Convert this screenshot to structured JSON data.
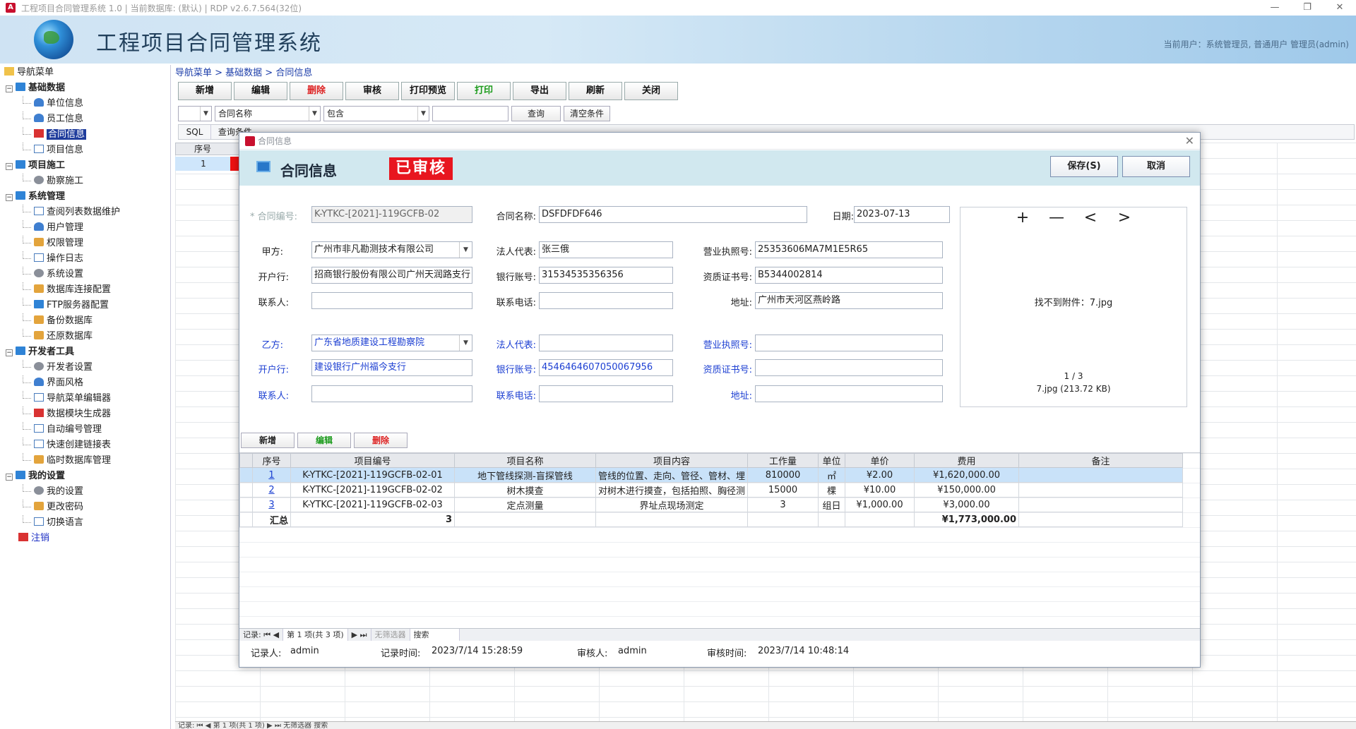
{
  "window": {
    "title": "工程项目合同管理系统 1.0 | 当前数据库: (默认) | RDP v2.6.7.564(32位)",
    "min": "—",
    "max": "❐",
    "close": "✕"
  },
  "banner": {
    "app_title": "工程项目合同管理系统",
    "current_user": "当前用户：系统管理员, 普通用户 管理员(admin)"
  },
  "nav": {
    "root": "导航菜单",
    "groups": [
      {
        "label": "基础数据",
        "items": [
          "单位信息",
          "员工信息",
          "合同信息",
          "项目信息"
        ]
      },
      {
        "label": "项目施工",
        "items": [
          "勘察施工"
        ]
      },
      {
        "label": "系统管理",
        "items": [
          "查阅列表数据维护",
          "用户管理",
          "权限管理",
          "操作日志",
          "系统设置",
          "数据库连接配置",
          "FTP服务器配置",
          "备份数据库",
          "还原数据库"
        ]
      },
      {
        "label": "开发者工具",
        "items": [
          "开发者设置",
          "界面风格",
          "导航菜单编辑器",
          "数据模块生成器",
          "自动编号管理",
          "快速创建链接表",
          "临时数据库管理"
        ]
      },
      {
        "label": "我的设置",
        "items": [
          "我的设置",
          "更改密码",
          "切换语言"
        ]
      }
    ],
    "logout": "注销"
  },
  "breadcrumb": "导航菜单 > 基础数据 > 合同信息",
  "toolbar": {
    "new": "新增",
    "edit": "编辑",
    "delete": "删除",
    "audit": "审核",
    "print_preview": "打印预览",
    "print": "打印",
    "export": "导出",
    "refresh": "刷新",
    "close": "关闭"
  },
  "filter": {
    "field": "合同名称",
    "op": "包含",
    "query": "查询",
    "clear": "清空条件",
    "sql": "SQL",
    "cond": "查询条件"
  },
  "bg_grid": {
    "col": "序号",
    "row1": "1",
    "status": "记录: ⏮ ◀ 第 1 项(共 1 项) ▶ ⏭ 无筛选器 搜索"
  },
  "dialog": {
    "titlebar": "合同信息",
    "header": "合同信息",
    "status_badge": "已审核",
    "save": "保存(S)",
    "cancel": "取消",
    "labels": {
      "contract_no": "* 合同编号:",
      "contract_name": "合同名称:",
      "date": "日期:",
      "party_a": "甲方:",
      "legal_rep": "法人代表:",
      "license": "营业执照号:",
      "bank": "开户行:",
      "account": "银行账号:",
      "cert": "资质证书号:",
      "contact": "联系人:",
      "phone": "联系电话:",
      "address": "地址:",
      "party_b": "乙方:"
    },
    "values": {
      "contract_no": "K-YTKC-[2021]-119GCFB-02",
      "contract_name": "DSFDFDF646",
      "date": "2023-07-13",
      "a_name": "广州市非凡勘测技术有限公司",
      "a_rep": "张三俄",
      "a_license": "25353606MA7M1E5R65",
      "a_bank": "招商银行股份有限公司广州天润路支行",
      "a_account": "31534535356356",
      "a_cert": "B5344002814",
      "a_contact": "",
      "a_phone": "",
      "a_address": "广州市天河区燕岭路",
      "b_name": "广东省地质建设工程勘察院",
      "b_rep": "",
      "b_license": "",
      "b_bank": "建设银行广州福今支行",
      "b_account": "4546464607050067956",
      "b_cert": "",
      "b_contact": "",
      "b_phone": "",
      "b_address": ""
    },
    "image": {
      "zoom_in": "+",
      "zoom_out": "—",
      "prev": "<",
      "next": ">",
      "not_found": "找不到附件：7.jpg",
      "page": "1 / 3",
      "file": "7.jpg (213.72 KB)"
    },
    "detail_toolbar": {
      "new": "新增",
      "edit": "编辑",
      "delete": "删除"
    },
    "table": {
      "headers": [
        "序号",
        "项目编号",
        "项目名称",
        "项目内容",
        "工作量",
        "单位",
        "单价",
        "费用",
        "备注"
      ],
      "rows": [
        [
          "1",
          "K-YTKC-[2021]-119GCFB-02-01",
          "地下管线探测-盲探管线",
          "管线的位置、走向、管径、管材、埋",
          "810000",
          "㎡",
          "¥2.00",
          "¥1,620,000.00",
          ""
        ],
        [
          "2",
          "K-YTKC-[2021]-119GCFB-02-02",
          "树木摸查",
          "对树木进行摸查，包括拍照、胸径测",
          "15000",
          "棵",
          "¥10.00",
          "¥150,000.00",
          ""
        ],
        [
          "3",
          "K-YTKC-[2021]-119GCFB-02-03",
          "定点测量",
          "界址点现场测定",
          "3",
          "组日",
          "¥1,000.00",
          "¥3,000.00",
          ""
        ]
      ],
      "summary": {
        "label": "汇总",
        "count": "3",
        "total": "¥1,773,000.00"
      }
    },
    "status": {
      "record": "记录: ⏮ ◀",
      "pos": "第 1 项(共 3 项)",
      "nav": "▶ ⏭",
      "filter": "无筛选器",
      "search": "搜索"
    },
    "footer": {
      "recorder_label": "记录人:",
      "recorder": "admin",
      "rec_time_label": "记录时间:",
      "rec_time": "2023/7/14 15:28:59",
      "auditor_label": "审核人:",
      "auditor": "admin",
      "audit_time_label": "审核时间:",
      "audit_time": "2023/7/14 10:48:14"
    }
  },
  "colors": {
    "accent": "#1f3c9c",
    "badge": "#e8161f",
    "link": "#1c3fd2",
    "header_bg": "#d1e8ef"
  }
}
